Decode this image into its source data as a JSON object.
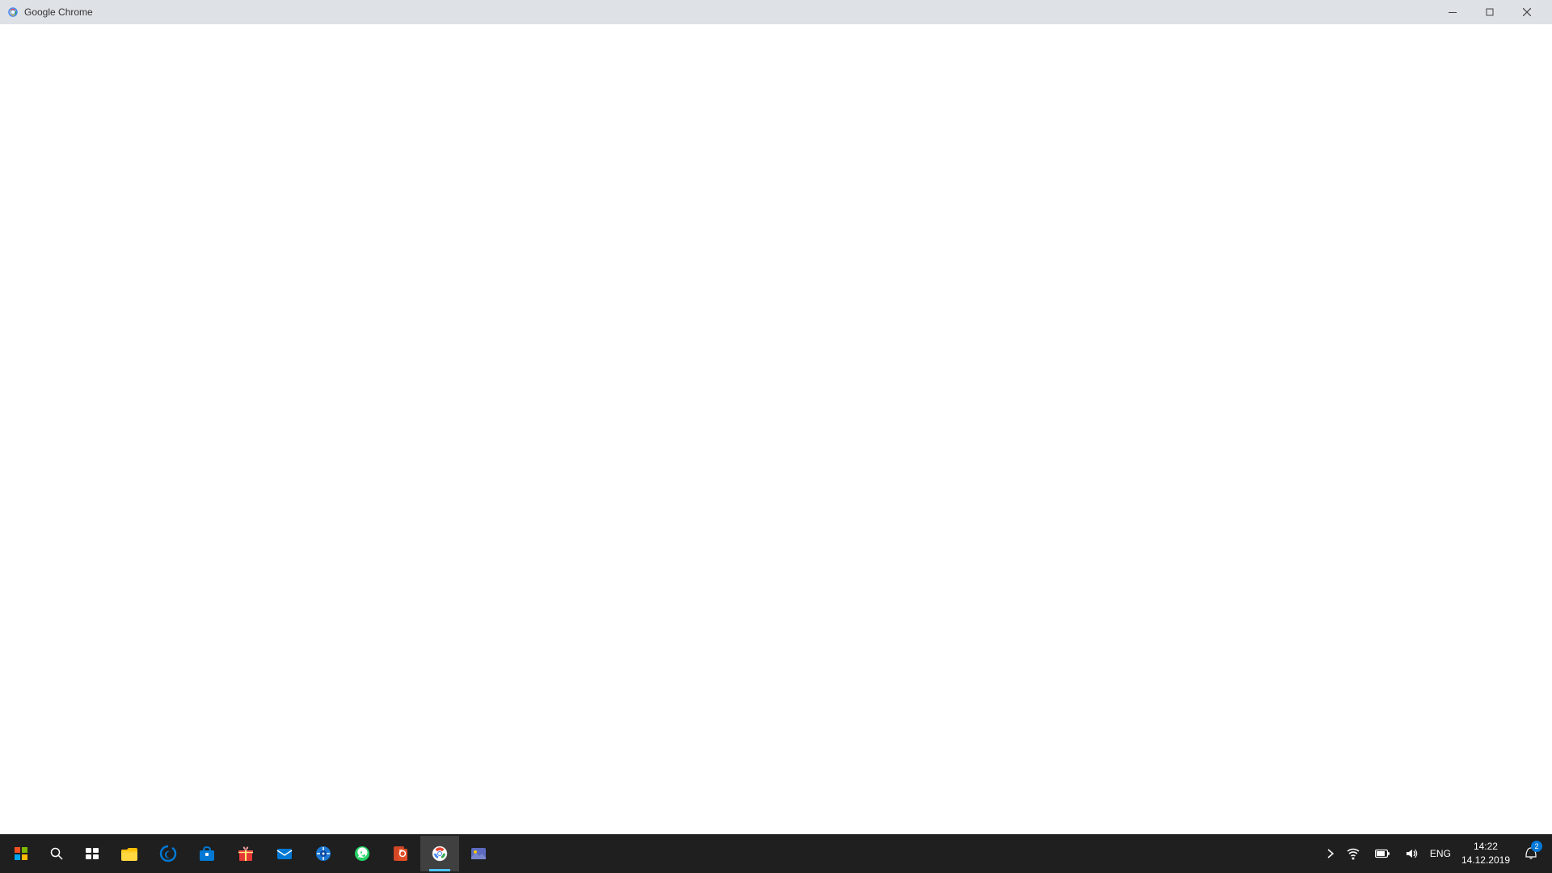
{
  "titlebar": {
    "title": "Google Chrome",
    "minimize_label": "Minimize",
    "restore_label": "Restore",
    "close_label": "Close"
  },
  "content": {
    "background": "#ffffff"
  },
  "taskbar": {
    "tray": {
      "show_hidden_label": "Show hidden icons",
      "wifi_label": "Wi-Fi",
      "battery_label": "Battery",
      "volume_label": "Volume",
      "lang": "ENG",
      "time": "14:22",
      "date": "14.12.2019",
      "notifications_label": "Notifications",
      "notifications_count": "2"
    },
    "pinned_apps": [
      {
        "name": "file-explorer",
        "label": "File Explorer",
        "active": false
      },
      {
        "name": "edge",
        "label": "Microsoft Edge",
        "active": false
      },
      {
        "name": "store",
        "label": "Microsoft Store",
        "active": false
      },
      {
        "name": "gift",
        "label": "Gift",
        "active": false
      },
      {
        "name": "mail",
        "label": "Mail",
        "active": false
      },
      {
        "name": "media",
        "label": "Media Player",
        "active": false
      },
      {
        "name": "whatsapp",
        "label": "WhatsApp",
        "active": false
      },
      {
        "name": "powerpoint",
        "label": "PowerPoint",
        "active": false
      },
      {
        "name": "chrome",
        "label": "Google Chrome",
        "active": true
      },
      {
        "name": "photos",
        "label": "Photos",
        "active": false
      }
    ]
  }
}
